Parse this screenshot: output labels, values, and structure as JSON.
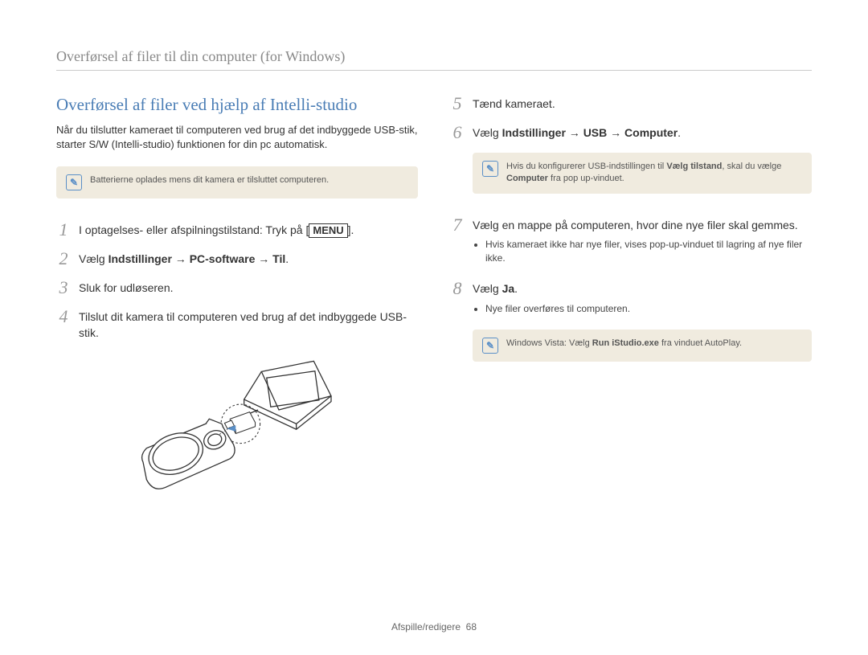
{
  "header": {
    "title": "Overførsel af filer til din computer (for Windows)"
  },
  "section": {
    "title": "Overførsel af filer ved hjælp af Intelli-studio",
    "intro": "Når du tilslutter kameraet til computeren ved brug af det indbyggede USB-stik, starter S/W (Intelli-studio) funktionen for din pc automatisk."
  },
  "notes": {
    "left1": "Batterierne oplades mens dit kamera er tilsluttet computeren.",
    "right1_pre": "Hvis du konfigurerer USB-indstillingen til ",
    "right1_bold1": "Vælg tilstand",
    "right1_mid": ", skal du vælge ",
    "right1_bold2": "Computer",
    "right1_post": " fra pop up-vinduet.",
    "right2_pre": "Windows Vista: Vælg ",
    "right2_bold": "Run iStudio.exe",
    "right2_post": " fra vinduet AutoPlay."
  },
  "steps": {
    "s1_pre": "I optagelses- eller afspilningstilstand: Tryk på [",
    "s1_menu": "MENU",
    "s1_post": "].",
    "s2_pre": "Vælg ",
    "s2_bold": "Indstillinger → PC-software → Til",
    "s2_post": ".",
    "s3": "Sluk for udløseren.",
    "s4": "Tilslut dit kamera til computeren ved brug af det indbyggede USB-stik.",
    "s5": "Tænd kameraet.",
    "s6_pre": "Vælg ",
    "s6_bold": "Indstillinger → USB → Computer",
    "s6_post": ".",
    "s7": "Vælg en mappe på computeren, hvor dine nye filer skal gemmes.",
    "s7_bullet": "Hvis kameraet ikke har nye filer, vises pop-up-vinduet til lagring af nye filer ikke.",
    "s8_pre": "Vælg ",
    "s8_bold": "Ja",
    "s8_post": ".",
    "s8_bullet": "Nye filer overføres til computeren."
  },
  "step_numbers": {
    "n1": "1",
    "n2": "2",
    "n3": "3",
    "n4": "4",
    "n5": "5",
    "n6": "6",
    "n7": "7",
    "n8": "8"
  },
  "footer": {
    "section": "Afspille/redigere",
    "page": "68"
  },
  "icons": {
    "note_glyph": "✎"
  }
}
